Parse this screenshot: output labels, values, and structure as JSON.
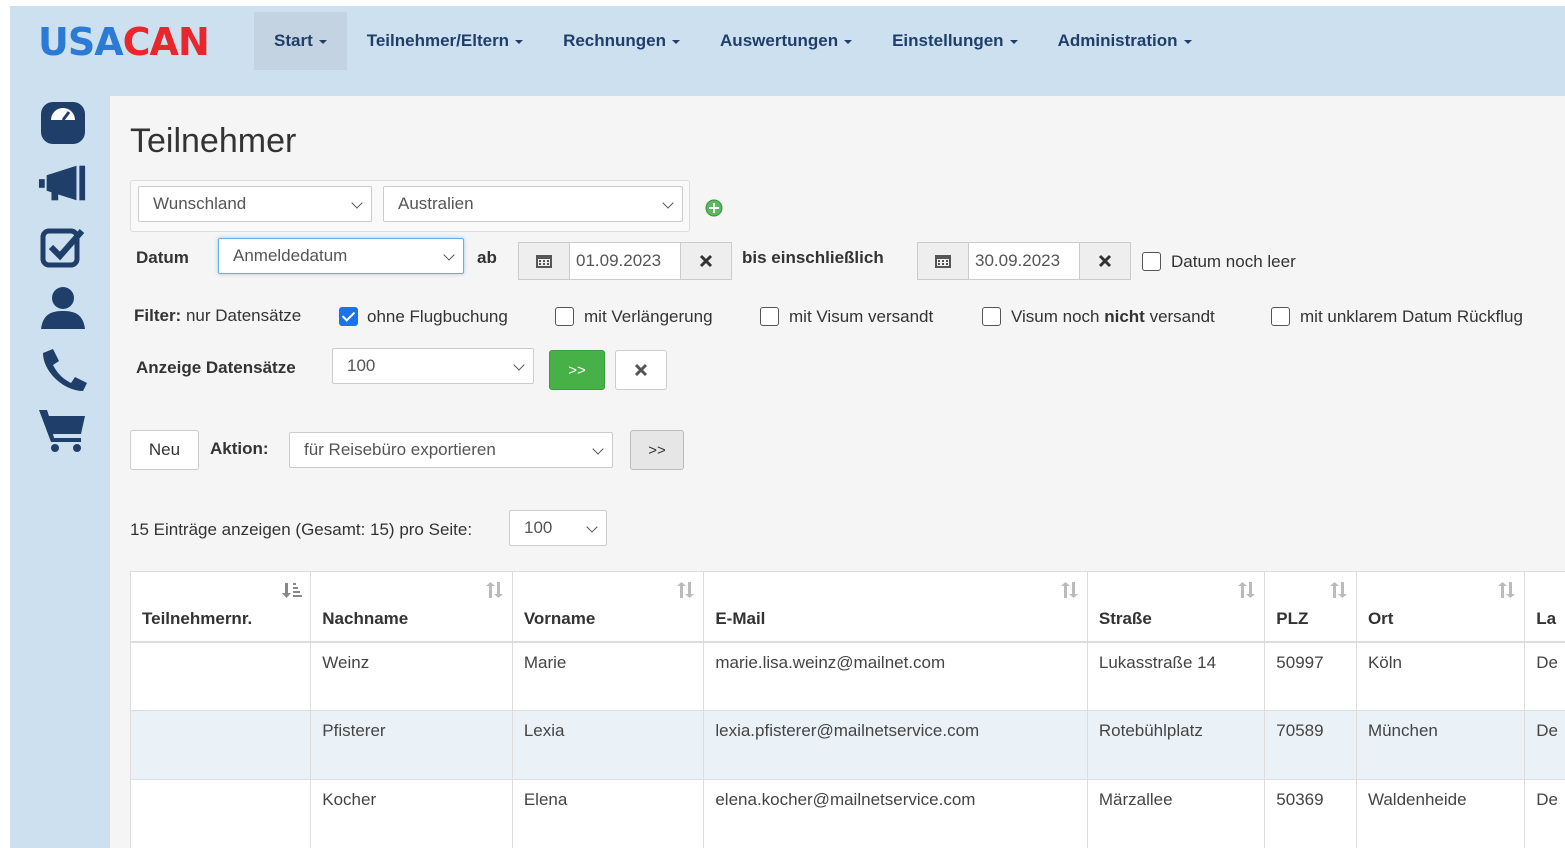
{
  "brand": {
    "part1": "USA",
    "part2": "CAN"
  },
  "nav": {
    "items": [
      {
        "label": "Start",
        "active": true
      },
      {
        "label": "Teilnehmer/Eltern",
        "active": false
      },
      {
        "label": "Rechnungen",
        "active": false
      },
      {
        "label": "Auswertungen",
        "active": false
      },
      {
        "label": "Einstellungen",
        "active": false
      },
      {
        "label": "Administration",
        "active": false
      }
    ]
  },
  "sidebar": {
    "icons": [
      "dashboard-icon",
      "megaphone-icon",
      "checklist-icon",
      "user-icon",
      "phone-icon",
      "cart-icon"
    ]
  },
  "page": {
    "title": "Teilnehmer"
  },
  "filter": {
    "field1": "Wunschland",
    "field2": "Australien"
  },
  "date": {
    "label": "Datum",
    "type": "Anmeldedatum",
    "from_label": "ab",
    "from": "01.09.2023",
    "to_label": "bis einschließlich",
    "to": "30.09.2023",
    "empty_label": "Datum noch leer"
  },
  "records_filter": {
    "label_bold": "Filter:",
    "label_rest": " nur Datensätze",
    "options": [
      {
        "label": "ohne Flugbuchung",
        "checked": true
      },
      {
        "label": "mit Verlängerung",
        "checked": false
      },
      {
        "label": "mit Visum versandt",
        "checked": false
      },
      {
        "label_pre": "Visum noch ",
        "label_bold": "nicht",
        "label_post": " versandt",
        "checked": false
      },
      {
        "label": "mit unklarem Datum Rückflug",
        "checked": false
      }
    ]
  },
  "display": {
    "label": "Anzeige Datensätze",
    "value": "100",
    "go": ">>"
  },
  "actions": {
    "new_label": "Neu",
    "action_label": "Aktion:",
    "action_value": "für Reisebüro exportieren",
    "go": ">>"
  },
  "paging": {
    "info": "15 Einträge anzeigen (Gesamt: 15) pro Seite:",
    "per_page": "100"
  },
  "table": {
    "columns": [
      "Teilnehmernr.",
      "Nachname",
      "Vorname",
      "E-Mail",
      "Straße",
      "PLZ",
      "Ort",
      "La"
    ],
    "rows": [
      [
        "",
        "Weinz",
        "Marie",
        "marie.lisa.weinz@mailnet.com",
        "Lukasstraße 14",
        "50997",
        "Köln",
        "De"
      ],
      [
        "",
        "Pfisterer",
        "Lexia",
        "lexia.pfisterer@mailnetservice.com",
        "Rotebühlplatz",
        "70589",
        "München",
        "De"
      ],
      [
        "",
        "Kocher",
        "Elena",
        "elena.kocher@mailnetservice.com",
        "Märzallee",
        "50369",
        "Waldenheide",
        "De"
      ]
    ]
  },
  "colors": {
    "nav_bg": "#cde0ef",
    "icon": "#1f3f6a",
    "green": "#47b047",
    "check": "#1a73e8"
  }
}
